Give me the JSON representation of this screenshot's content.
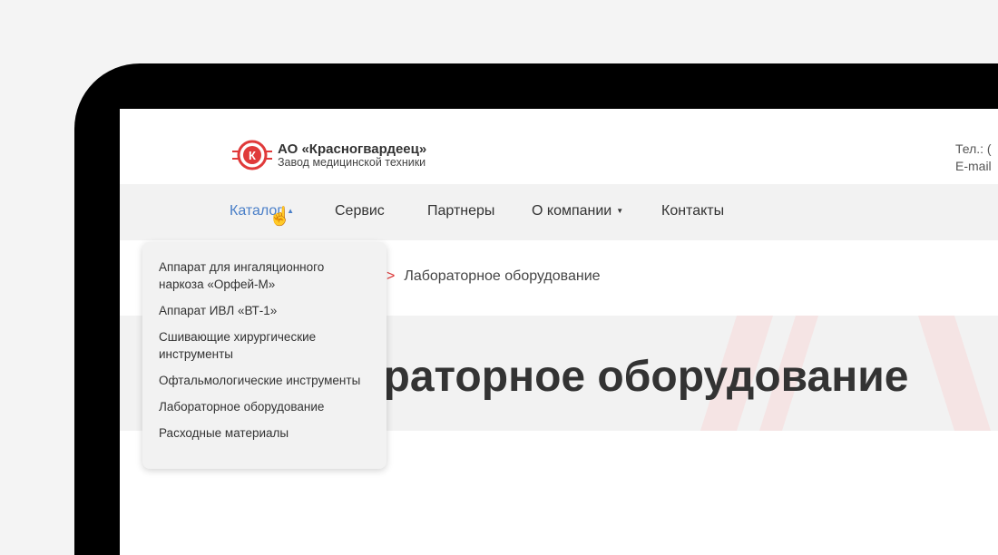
{
  "header": {
    "company": "АО «Красногвардеец»",
    "subtitle": "Завод медицинской техники",
    "phone_label": "Тел.: (",
    "email_label": "E-mail"
  },
  "nav": {
    "items": [
      {
        "label": "Каталог",
        "caret": "▲"
      },
      {
        "label": "Сервис"
      },
      {
        "label": "Партнеры"
      },
      {
        "label": "О компании",
        "caret": "▼"
      },
      {
        "label": "Контакты"
      }
    ]
  },
  "breadcrumb": {
    "separator": ">",
    "current": "Лабораторное оборудование"
  },
  "hero": {
    "title": "Лабораторное оборудование"
  },
  "dropdown": {
    "items": [
      "Аппарат для ингаляционного наркоза «Орфей-М»",
      "Аппарат ИВЛ «ВТ-1»",
      "Сшивающие хирургические инструменты",
      "Офтальмологические инструменты",
      "Лабораторное оборудование",
      "Расходные материалы"
    ]
  },
  "colors": {
    "accent": "#4a7fc8",
    "brand": "#e03a3a"
  }
}
